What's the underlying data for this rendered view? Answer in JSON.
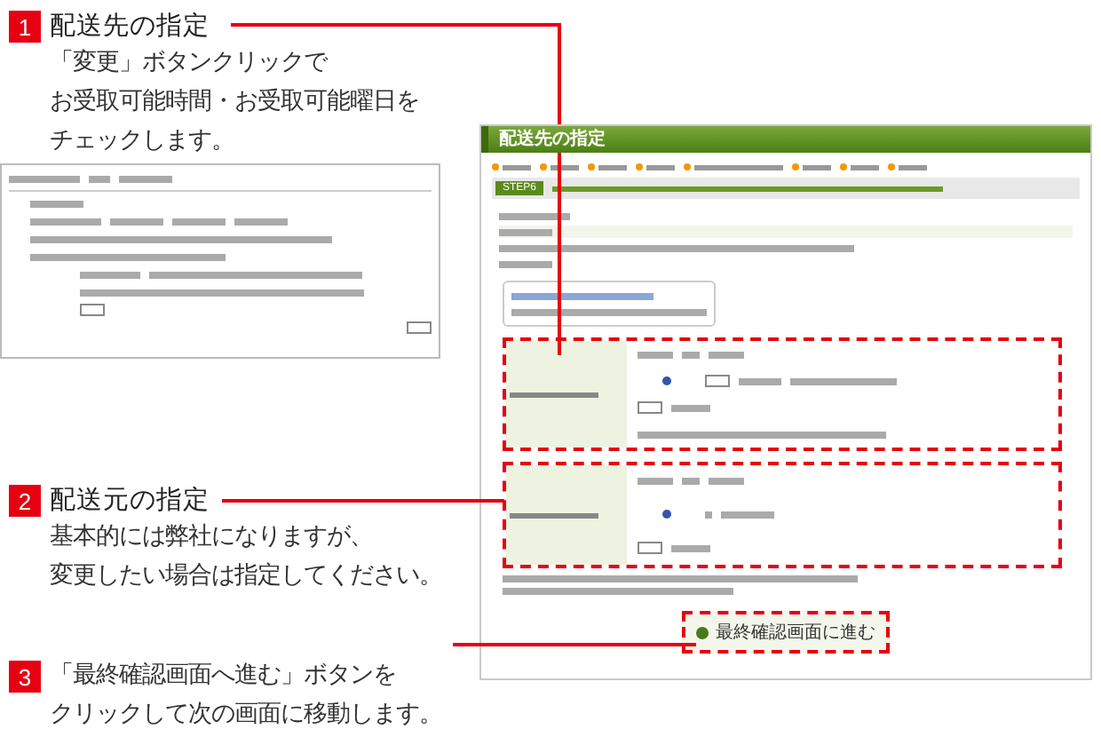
{
  "annotations": [
    {
      "number": "1",
      "title": "配送先の指定",
      "lines": [
        "「変更」ボタンクリックで",
        "お受取可能時間・お受取可能曜日を",
        "チェックします。"
      ]
    },
    {
      "number": "2",
      "title": "配送元の指定",
      "lines": [
        "基本的には弊社になりますが、",
        "変更したい場合は指定してください。"
      ]
    },
    {
      "number": "3",
      "lines": [
        "「最終確認画面へ進む」ボタンを",
        "クリックして次の画面に移動します。"
      ]
    }
  ],
  "screenshot": {
    "title": "配送先の指定",
    "step": "STEP6",
    "button": "最終確認画面に進む"
  }
}
